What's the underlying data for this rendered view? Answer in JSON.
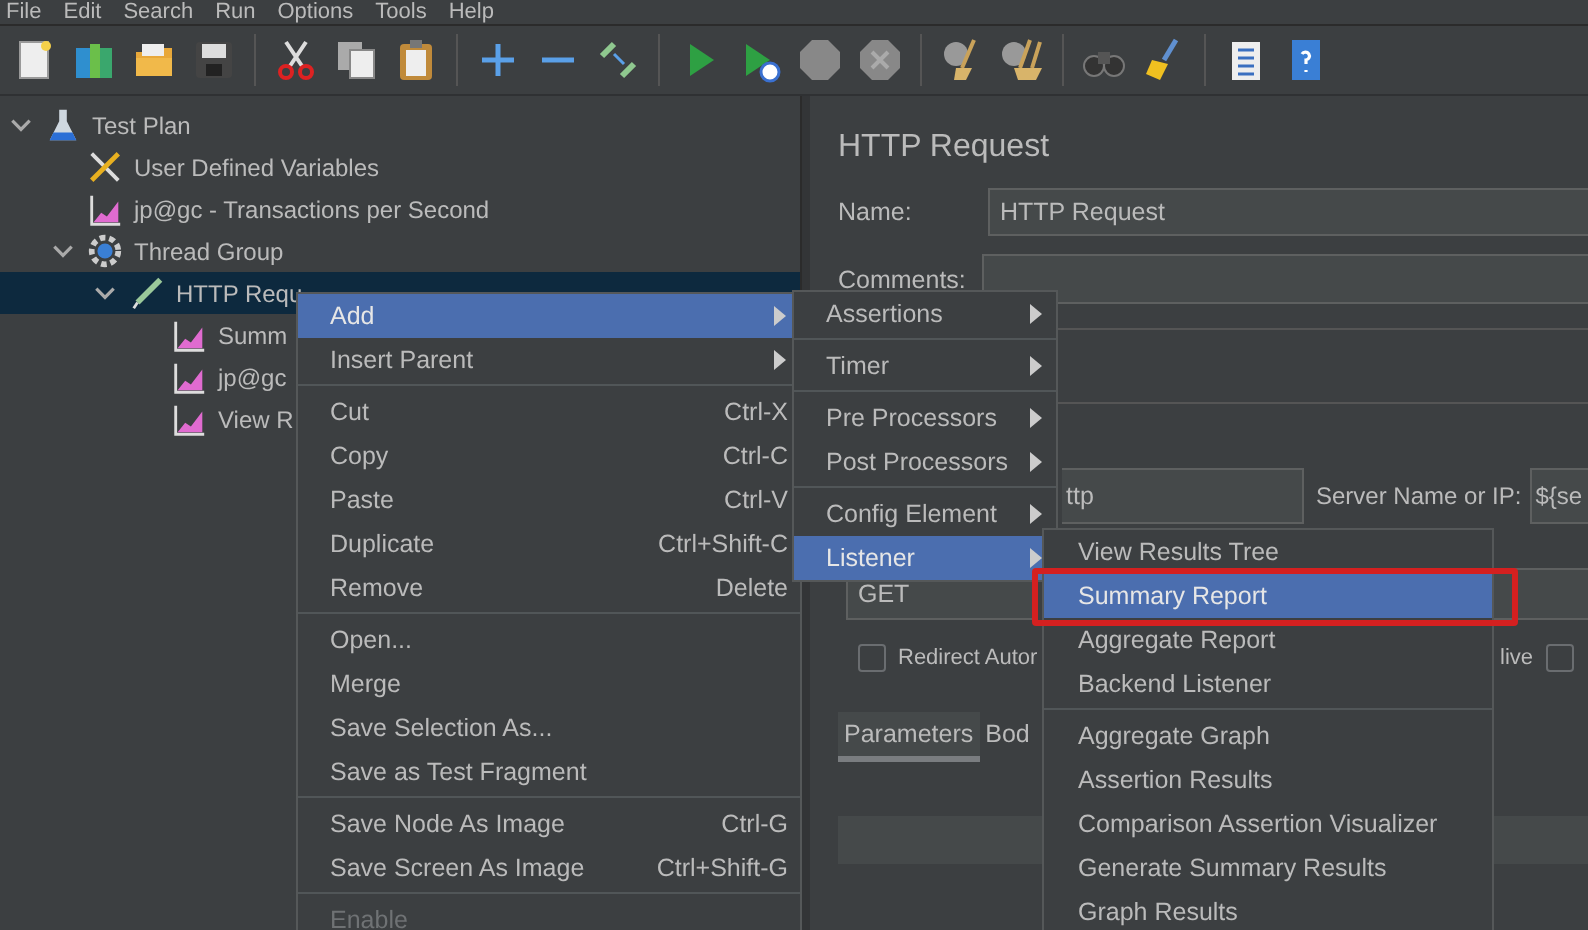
{
  "menu_bar": [
    "File",
    "Edit",
    "Search",
    "Run",
    "Options",
    "Tools",
    "Help"
  ],
  "tree": [
    {
      "label": "Test Plan",
      "kind": "test_plan",
      "expanded": true,
      "selected": false,
      "children": [
        {
          "label": "User Defined Variables",
          "kind": "config",
          "selected": false
        },
        {
          "label": "jp@gc - Transactions per Second",
          "kind": "listener",
          "selected": false
        },
        {
          "label": "Thread Group",
          "kind": "thread_group",
          "expanded": true,
          "selected": false,
          "children": [
            {
              "label": "HTTP Requ",
              "kind": "sampler",
              "expanded": true,
              "selected": true,
              "children": [
                {
                  "label": "Summ",
                  "kind": "listener",
                  "selected": false
                },
                {
                  "label": "jp@gc",
                  "kind": "listener",
                  "selected": false
                },
                {
                  "label": "View R",
                  "kind": "listener",
                  "selected": false
                }
              ]
            }
          ]
        }
      ]
    }
  ],
  "panel": {
    "title": "HTTP Request",
    "name_label": "Name:",
    "name_value": "HTTP Request",
    "comments_label": "Comments:",
    "protocol_value": "ttp",
    "server_label": "Server Name or IP:",
    "server_value": "${se",
    "method_value": "GET",
    "checkboxes": [
      {
        "label": "Redirect Autor",
        "checked": false
      },
      {
        "label": "live",
        "checked": false
      }
    ],
    "tabs": [
      {
        "label": "Parameters",
        "selected": true
      },
      {
        "label": "Bod",
        "selected": false
      }
    ]
  },
  "context_menu": {
    "groups": [
      [
        {
          "label": "Add",
          "submenu": true,
          "selected": true,
          "disabled": false
        },
        {
          "label": "Insert Parent",
          "submenu": true,
          "selected": false,
          "disabled": false
        }
      ],
      [
        {
          "label": "Cut",
          "shortcut": "Ctrl-X",
          "selected": false,
          "disabled": false
        },
        {
          "label": "Copy",
          "shortcut": "Ctrl-C",
          "selected": false,
          "disabled": false
        },
        {
          "label": "Paste",
          "shortcut": "Ctrl-V",
          "selected": false,
          "disabled": false
        },
        {
          "label": "Duplicate",
          "shortcut": "Ctrl+Shift-C",
          "selected": false,
          "disabled": false
        },
        {
          "label": "Remove",
          "shortcut": "Delete",
          "selected": false,
          "disabled": false
        }
      ],
      [
        {
          "label": "Open...",
          "selected": false,
          "disabled": false
        },
        {
          "label": "Merge",
          "selected": false,
          "disabled": false
        },
        {
          "label": "Save Selection As...",
          "selected": false,
          "disabled": false
        },
        {
          "label": "Save as Test Fragment",
          "selected": false,
          "disabled": false
        }
      ],
      [
        {
          "label": "Save Node As Image",
          "shortcut": "Ctrl-G",
          "selected": false,
          "disabled": false
        },
        {
          "label": "Save Screen As Image",
          "shortcut": "Ctrl+Shift-G",
          "selected": false,
          "disabled": false
        }
      ],
      [
        {
          "label": "Enable",
          "selected": false,
          "disabled": true
        }
      ]
    ]
  },
  "add_submenu": {
    "groups": [
      [
        {
          "label": "Assertions",
          "submenu": true,
          "selected": false
        }
      ],
      [
        {
          "label": "Timer",
          "submenu": true,
          "selected": false
        }
      ],
      [
        {
          "label": "Pre Processors",
          "submenu": true,
          "selected": false
        },
        {
          "label": "Post Processors",
          "submenu": true,
          "selected": false
        }
      ],
      [
        {
          "label": "Config Element",
          "submenu": true,
          "selected": false
        },
        {
          "label": "Listener",
          "submenu": true,
          "selected": true
        }
      ]
    ]
  },
  "listener_submenu": {
    "highlighted": true,
    "groups": [
      [
        {
          "label": "View Results Tree",
          "selected": false
        },
        {
          "label": "Summary Report",
          "selected": true
        },
        {
          "label": "Aggregate Report",
          "selected": false
        },
        {
          "label": "Backend Listener",
          "selected": false
        }
      ],
      [
        {
          "label": "Aggregate Graph",
          "selected": false
        },
        {
          "label": "Assertion Results",
          "selected": false
        },
        {
          "label": "Comparison Assertion Visualizer",
          "selected": false
        },
        {
          "label": "Generate Summary Results",
          "selected": false
        },
        {
          "label": "Graph Results",
          "selected": false
        }
      ]
    ]
  }
}
